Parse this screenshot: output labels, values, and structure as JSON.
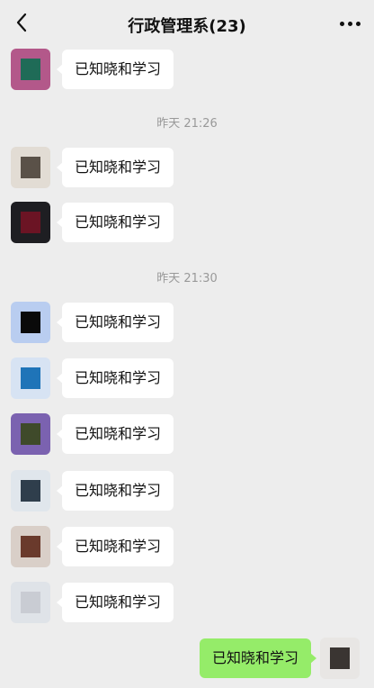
{
  "header": {
    "title": "行政管理系(23)",
    "back_icon": "chevron-left-icon",
    "more_icon": "more-horizontal-icon"
  },
  "timestamps": [
    "昨天 21:26",
    "昨天 21:30"
  ],
  "messages": [
    {
      "text": "已知晓和学习",
      "side": "left",
      "avatar_colors": [
        "#b3588a",
        "#1f6b57"
      ]
    },
    {
      "text": "已知晓和学习",
      "side": "left",
      "avatar_colors": [
        "#e2dcd4",
        "#5a5148"
      ]
    },
    {
      "text": "已知晓和学习",
      "side": "left",
      "avatar_colors": [
        "#1e1e22",
        "#6b1424"
      ]
    },
    {
      "text": "已知晓和学习",
      "side": "left",
      "avatar_colors": [
        "#b9cdf0",
        "#0a0a0a"
      ]
    },
    {
      "text": "已知晓和学习",
      "side": "left",
      "avatar_colors": [
        "#d7e3f3",
        "#1f74b8"
      ]
    },
    {
      "text": "已知晓和学习",
      "side": "left",
      "avatar_colors": [
        "#7b62b0",
        "#3f4a2a"
      ]
    },
    {
      "text": "已知晓和学习",
      "side": "left",
      "avatar_colors": [
        "#e0e6ec",
        "#2f3e4c"
      ]
    },
    {
      "text": "已知晓和学习",
      "side": "left",
      "avatar_colors": [
        "#d9cfc8",
        "#6a3a2c"
      ]
    },
    {
      "text": "已知晓和学习",
      "side": "left",
      "avatar_colors": [
        "#dfe3e8",
        "#c9ccd3"
      ]
    },
    {
      "text": "已知晓和学习",
      "side": "right",
      "avatar_colors": [
        "#e8e6e4",
        "#3a3532"
      ]
    }
  ]
}
